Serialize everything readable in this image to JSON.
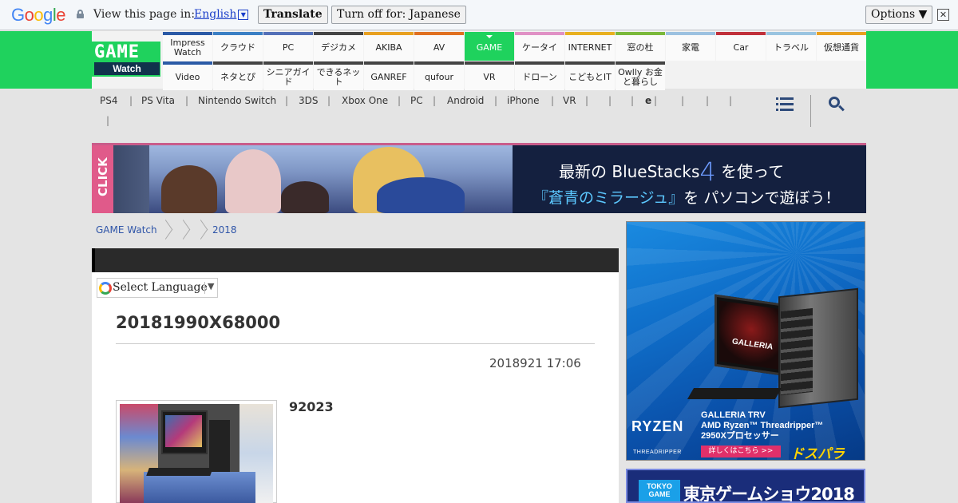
{
  "translate_bar": {
    "logo_letters": [
      {
        "ch": "G",
        "color": "#4285f4"
      },
      {
        "ch": "o",
        "color": "#ea4335"
      },
      {
        "ch": "o",
        "color": "#fbbc05"
      },
      {
        "ch": "g",
        "color": "#4285f4"
      },
      {
        "ch": "l",
        "color": "#34a853"
      },
      {
        "ch": "e",
        "color": "#ea4335"
      }
    ],
    "view_text": "View this page in:",
    "language": "English",
    "translate_button": "Translate",
    "turn_off_button": "Turn off for: Japanese",
    "options_button": "Options ▼",
    "close": "✕"
  },
  "header": {
    "logo_top": "GAME",
    "logo_bottom": "Watch",
    "nav_row1": [
      {
        "label": "Impress Watch",
        "color": "#2b5aa6"
      },
      {
        "label": "クラウド",
        "color": "#3b7fc4"
      },
      {
        "label": "PC",
        "color": "#5470b8"
      },
      {
        "label": "デジカメ",
        "color": "#444"
      },
      {
        "label": "AKIBA",
        "color": "#e8a020"
      },
      {
        "label": "AV",
        "color": "#e07020"
      },
      {
        "label": "GAME",
        "color": "#1fd25d",
        "active": true
      },
      {
        "label": "ケータイ",
        "color": "#e091c5"
      },
      {
        "label": "INTERNET",
        "color": "#e8b020"
      },
      {
        "label": "窓の杜",
        "color": "#7ab83a"
      },
      {
        "label": "家電",
        "color": "#9cc1e0"
      },
      {
        "label": "Car",
        "color": "#c0303a"
      },
      {
        "label": "トラベル",
        "color": "#9ac4e0"
      },
      {
        "label": "仮想通貨",
        "color": "#e8a020"
      }
    ],
    "nav_row2": [
      {
        "label": "Video",
        "color": "#2b5aa6"
      },
      {
        "label": "ネタとぴ",
        "color": "#444"
      },
      {
        "label": "シニアガイド",
        "color": "#444"
      },
      {
        "label": "できるネット",
        "color": "#444"
      },
      {
        "label": "GANREF",
        "color": "#444"
      },
      {
        "label": "qufour",
        "color": "#444"
      },
      {
        "label": "VR",
        "color": "#444"
      },
      {
        "label": "ドローン",
        "color": "#444"
      },
      {
        "label": "こどもとIT",
        "color": "#444"
      },
      {
        "label": "Owlly お金と暮らし",
        "color": "#444"
      }
    ]
  },
  "platform_nav": {
    "items": [
      "PS4",
      "PS Vita",
      "Nintendo Switch",
      "3DS",
      "Xbox One",
      "PC",
      "Android",
      "iPhone",
      "VR",
      "",
      "",
      "e",
      "",
      "",
      "",
      ""
    ]
  },
  "banner": {
    "click": "CLICK",
    "line1_a": "最新の BlueStacks",
    "line1_four": "4",
    "line1_b": " を使って",
    "line2_a": "『蒼青のミラージュ』",
    "line2_b": "を パソコンで遊ぼう！"
  },
  "breadcrumb": [
    "GAME Watch",
    "",
    "2018"
  ],
  "article": {
    "language_select": "Select Language",
    "title": "20181990X68000",
    "date": "2018921 17:06",
    "subheading": "92023"
  },
  "ads": {
    "ad1_ryzen": "RYZEN",
    "ad1_threadripper": "THREADRIPPER",
    "ad1_monitor_brand": "GALLERIA",
    "ad1_spec1": "GALLERIA TRV",
    "ad1_spec2": "AMD Ryzen™ Threadripper™",
    "ad1_spec3": "2950Xプロセッサー",
    "ad1_cta": "詳しくはこちら >>",
    "ad1_brand": "ドスパラ",
    "ad2_box": "TOKYO GAME",
    "ad2_title": "東京ゲームショウ2018"
  }
}
